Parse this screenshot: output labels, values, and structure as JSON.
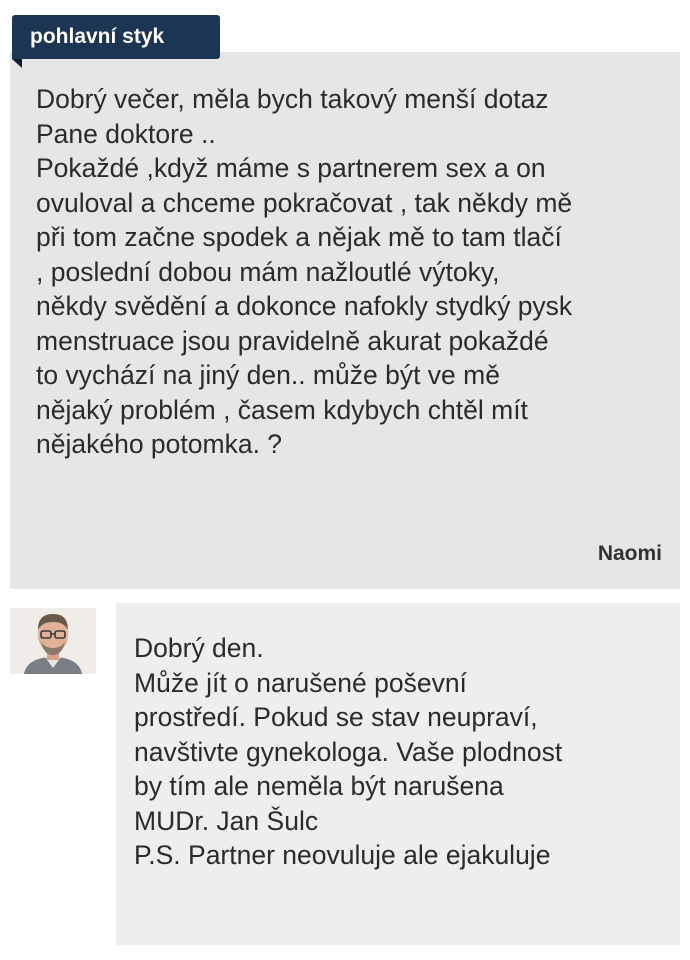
{
  "question": {
    "topic_tag": "pohlavní styk",
    "text": "Dobrý večer, měla bych takový menší dotaz\nPane doktore ..\nPokaždé ,když máme s partnerem sex a on\novuloval a chceme pokračovat , tak někdy mě\npři tom začne spodek a nějak mě to tam tlačí\n, poslední dobou mám nažloutlé výtoky,\nněkdy svědění a dokonce nafokly stydký pysk\nmenstruace jsou pravidelně akurat pokaždé\nto vychází na jiný den.. může být ve mě\nnějaký problém , časem kdybych chtěl mít\nnějakého potomka. ?",
    "author": "Naomi"
  },
  "answer": {
    "text": "Dobrý den.\nMůže jít o narušené poševní\nprostředí. Pokud se stav neupraví,\nnavštivte gynekologa. Vaše plodnost\nby tím ale neměla být narušena\nMUDr. Jan Šulc\nP.S. Partner neovuluje ale ejakuluje"
  },
  "colors": {
    "tag_background": "#1b3552",
    "question_background": "#e6e6e6",
    "answer_background": "#eeeeee",
    "text": "#2b2b2b"
  },
  "icons": {
    "avatar": "doctor-avatar-photo"
  }
}
